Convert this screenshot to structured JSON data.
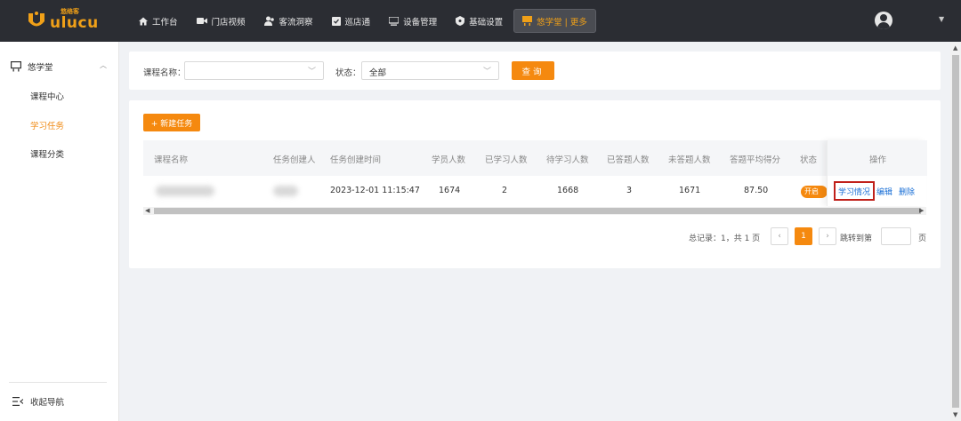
{
  "brand": {
    "logo_text": "ulucu",
    "logo_cn": "悠络客",
    "accent_color": "#f5890f"
  },
  "nav": [
    {
      "label": "工作台",
      "icon": "home-icon",
      "active": false
    },
    {
      "label": "门店视频",
      "icon": "video-camera-icon",
      "active": false
    },
    {
      "label": "客流洞察",
      "icon": "people-icon",
      "active": false
    },
    {
      "label": "巡店通",
      "icon": "clipboard-check-icon",
      "active": false
    },
    {
      "label": "设备管理",
      "icon": "device-icon",
      "active": false
    },
    {
      "label": "基础设置",
      "icon": "settings-shield-icon",
      "active": false
    },
    {
      "label": "悠学堂 | 更多",
      "icon": "classroom-icon",
      "active": true
    }
  ],
  "sidebar": {
    "group_label": "悠学堂",
    "items": [
      {
        "label": "课程中心",
        "active": false
      },
      {
        "label": "学习任务",
        "active": true
      },
      {
        "label": "课程分类",
        "active": false
      }
    ],
    "collapse_label": "收起导航"
  },
  "filters": {
    "course_name_label": "课程名称：",
    "course_name_value": "",
    "status_label": "状态：",
    "status_value": "全部",
    "query_button": "查询"
  },
  "toolbar": {
    "new_task_button": "+ 新建任务"
  },
  "table": {
    "columns": [
      "课程名称",
      "任务创建人",
      "任务创建时间",
      "学员人数",
      "已学习人数",
      "待学习人数",
      "已答题人数",
      "未答题人数",
      "答题平均得分",
      "状态",
      "操作"
    ],
    "rows": [
      {
        "created_time": "2023-12-01 11:15:47",
        "students": "1674",
        "learned": "2",
        "to_learn": "1668",
        "answered": "3",
        "unanswered": "1671",
        "avg_score": "87.50",
        "status": "开启",
        "actions": [
          "学习情况",
          "编辑",
          "删除"
        ]
      }
    ]
  },
  "pagination": {
    "summary": "总记录：1，共 1 页",
    "current_page": "1",
    "jump_label": "跳转到第",
    "page_suffix": "页"
  }
}
